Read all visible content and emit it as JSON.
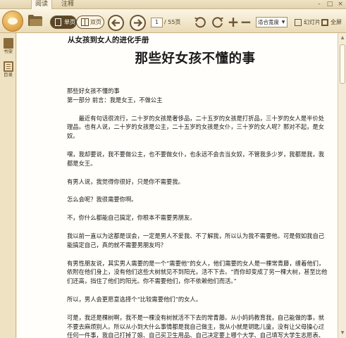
{
  "tabs": [
    {
      "label": "阅读",
      "active": true
    },
    {
      "label": "注释",
      "active": false
    }
  ],
  "window_controls": [
    "-",
    "□",
    "×"
  ],
  "toolbar": {
    "view_single": "单页",
    "view_double": "双页",
    "current_page": "1",
    "total_pages": "/ 55页",
    "fit_mode": "适合宽度",
    "slideshow": "幻灯片",
    "fullscreen": "全屏"
  },
  "sidebar": {
    "items": [
      {
        "label": "书架",
        "icon": "bookshelf-icon"
      },
      {
        "label": "目录",
        "icon": "toc-icon"
      }
    ]
  },
  "document": {
    "running_header": "从女孩到女人的进化手册",
    "chapter_title": "那些好女孩不懂的事",
    "section_title": "那些好女孩不懂的事",
    "part_line": "第一部分  前言：我是女王，不做公主",
    "p1": "最近有句话很流行，二十岁的女孩是奢侈品，二十五岁的女孩是打折品，三十岁的女人是半价处理品。也有人说，二十岁的女孩是公主，二十五岁的女孩是女仆，三十岁的女人呢？那对不起，是女奴。",
    "p2": "嘿，我却要说，我不要做公主，也不要做女仆，也永远不会去当女奴，不管我多少岁，我都是我，我都是女王。",
    "p3": "有男人说，我觉得你很好，只是你不需要我。",
    "p4": "怎么会呢？我很需要你啊。",
    "p5": "不，你什么都能自己搞定，你根本不需要男朋友。",
    "p6": "我以前一直以为这都是误会，一定是男人不爱我、不了解我，所以认为我不需要他。可是假如我自己能搞定自己，真的就不需要男朋友吗？",
    "p7": "有男性朋友说，其实男人需要的是一个“需要他”的女人，他们需要的女人是一棵常青藤，缠着他们，依附在他们身上，没有他们这些大树就见不到阳光，活不下去。“而你却变成了另一棵大树，甚至比他们还高，挡住了他们的阳光。你不需要他们，你不依赖他们而活。”",
    "p8": "所以，男人会更愿意选择个“比较需要他们”的女人。",
    "p9": "可是，我还是棵树啊，我不是一棵没有树就活不下去的常青藤。从小妈妈教育我，自己能做的事，就不要去麻烦别人。所以从小到大什么事情都是我自己做主，我从小就是钥匙儿童，没有让父母操心过任何一件事，我自己打掉了娘、自己买卫生用品、自己决定要上哪个大学、自己填写大学生志愿表、自己选择想要生活的城市、自己找工作、自己努力赚钱，自己买车买房，难道，这"
  }
}
